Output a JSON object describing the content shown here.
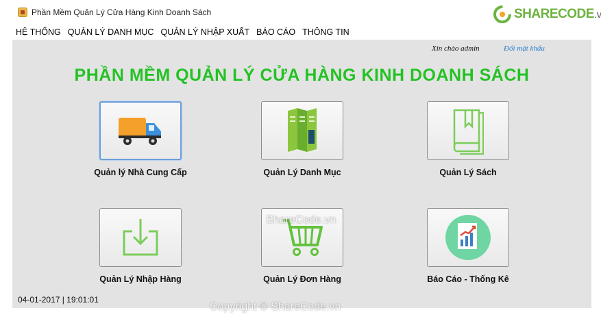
{
  "window": {
    "title": "Phần Mềm Quản Lý Cửa Hàng Kinh Doanh Sách"
  },
  "brand": {
    "name": "SHARECODE",
    "tld": ".vn",
    "color": "#6db33f"
  },
  "menu": {
    "items": [
      "HỆ THỐNG",
      "QUẢN LÝ DANH MỤC",
      "QUẢN LÝ NHẬP XUẤT",
      "BÁO CÁO",
      "THÔNG TIN"
    ]
  },
  "header": {
    "greeting": "Xin chào admin",
    "change_password": "Đổi mật khẩu",
    "title": "PHẦN MỀM QUẢN LÝ CỬA HÀNG KINH DOANH SÁCH"
  },
  "tiles": [
    {
      "label": "Quản lý Nhà Cung Cấp",
      "icon": "truck-icon"
    },
    {
      "label": "Quản Lý Danh Mục",
      "icon": "brochure-icon"
    },
    {
      "label": "Quản Lý Sách",
      "icon": "book-icon"
    },
    {
      "label": "Quản Lý Nhập Hàng",
      "icon": "import-icon"
    },
    {
      "label": "Quản Lý Đơn Hàng",
      "icon": "cart-icon"
    },
    {
      "label": "Báo Cáo - Thống Kê",
      "icon": "report-chart-icon"
    }
  ],
  "status": {
    "datetime": "04-01-2017 | 19:01:01"
  },
  "watermarks": {
    "center": "ShareCode.vn",
    "bottom": "Copyright © ShareCode.vn"
  },
  "colors": {
    "heading": "#24c224",
    "icon_green": "#6fcf4f",
    "selection_border": "#6c9fd9"
  }
}
